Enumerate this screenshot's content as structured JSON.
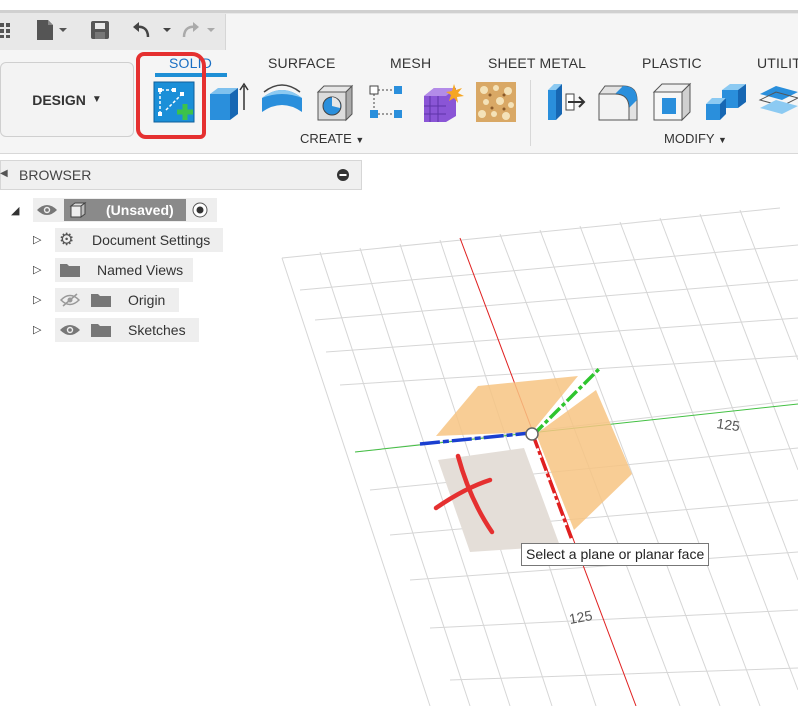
{
  "design_button": {
    "label": "DESIGN"
  },
  "tabs": [
    {
      "label": "SOLID",
      "active": true
    },
    {
      "label": "SURFACE",
      "active": false
    },
    {
      "label": "MESH",
      "active": false
    },
    {
      "label": "SHEET METAL",
      "active": false
    },
    {
      "label": "PLASTIC",
      "active": false
    },
    {
      "label": "UTILIT",
      "active": false
    }
  ],
  "groups": {
    "create_label": "CREATE",
    "modify_label": "MODIFY"
  },
  "toolbar_tools": {
    "create": [
      "create-sketch-icon",
      "extrude-icon",
      "revolve-icon",
      "hole-icon",
      "pattern-icon",
      "create-form-icon",
      "insert-mesh-icon"
    ],
    "modify": [
      "press-pull-icon",
      "fillet-icon",
      "shell-icon",
      "combine-icon",
      "offset-plane-icon"
    ]
  },
  "browser": {
    "title": "BROWSER",
    "root": {
      "label": "(Unsaved)"
    },
    "items": [
      {
        "label": "Document Settings",
        "icon": "gear-icon"
      },
      {
        "label": "Named Views",
        "icon": "folder-icon"
      },
      {
        "label": "Origin",
        "icon": "folder-icon",
        "visibility": "hidden"
      },
      {
        "label": "Sketches",
        "icon": "folder-icon",
        "visibility": "visible"
      }
    ]
  },
  "viewport": {
    "grid_labels": [
      "125",
      "125"
    ],
    "tooltip": "Select a plane or planar face"
  },
  "colors": {
    "accent": "#1e8fd5",
    "annotation_red": "#e53030",
    "plane_orange": "#f7c483",
    "plane_grey": "#e4ded8",
    "axis_red": "#e02020",
    "axis_green": "#2ec52e",
    "axis_blue": "#1a3fd0"
  }
}
